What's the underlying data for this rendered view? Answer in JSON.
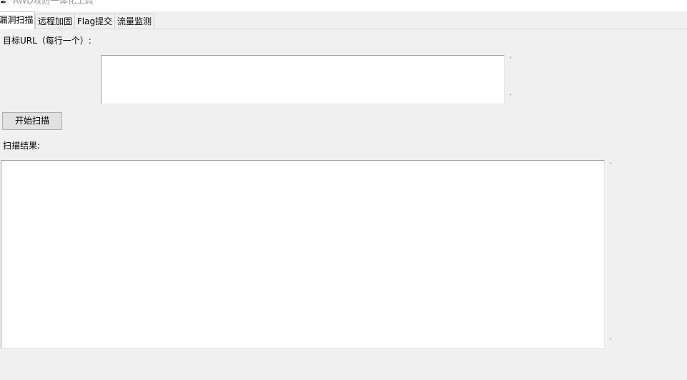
{
  "window": {
    "title": "AWD攻防一体化工具",
    "icon": "feather-icon",
    "minimize_icon": "minimize-icon",
    "maximize_icon": "maximize-icon"
  },
  "tabs": [
    {
      "label": "漏洞扫描",
      "active": true
    },
    {
      "label": "远程加固",
      "active": false
    },
    {
      "label": "Flag提交",
      "active": false
    },
    {
      "label": "流量监测",
      "active": false
    }
  ],
  "scan": {
    "url_label": "目标URL（每行一个）:",
    "url_value": "",
    "start_button": "开始扫描",
    "result_label": "扫描结果:",
    "result_value": ""
  },
  "colors": {
    "background": "#f0f0f0",
    "text_box": "#ffffff",
    "button": "#e1e1e1"
  }
}
